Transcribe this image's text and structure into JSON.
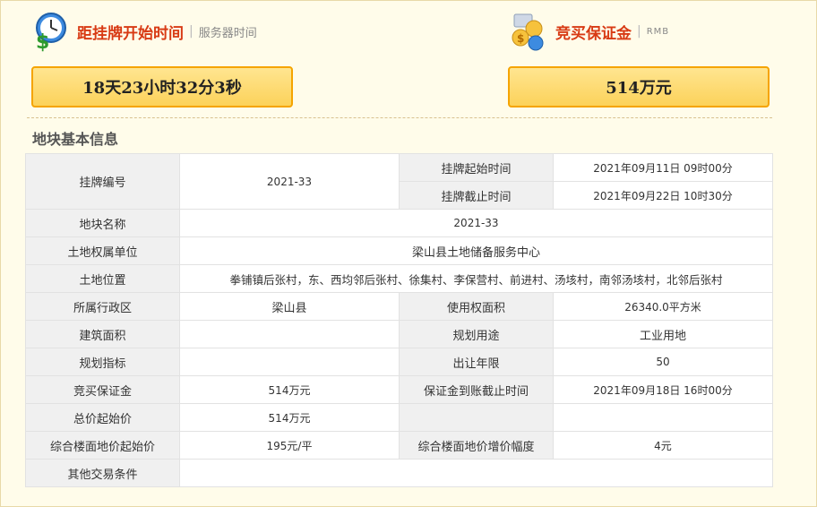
{
  "header": {
    "start_time": {
      "title": "距挂牌开始时间",
      "subtitle": "服务器时间",
      "countdown": "18天23小时32分3秒"
    },
    "deposit": {
      "title": "竞买保证金",
      "subtitle": "RMB",
      "amount": "514万元"
    }
  },
  "section": {
    "title": "地块基本信息"
  },
  "table": {
    "r1": {
      "l1": "挂牌编号",
      "v1": "2021-33",
      "l2a": "挂牌起始时间",
      "v2a": "2021年09月11日 09时00分",
      "l2b": "挂牌截止时间",
      "v2b": "2021年09月22日 10时30分"
    },
    "r3": {
      "l": "地块名称",
      "v": "2021-33"
    },
    "r4": {
      "l": "土地权属单位",
      "v": "梁山县土地储备服务中心"
    },
    "r5": {
      "l": "土地位置",
      "v": "拳铺镇后张村，东、西均邻后张村、徐集村、李保营村、前进村、汤垓村，南邻汤垓村，北邻后张村"
    },
    "r6": {
      "l1": "所属行政区",
      "v1": "梁山县",
      "l2": "使用权面积",
      "v2": "26340.0平方米"
    },
    "r7": {
      "l1": "建筑面积",
      "v1": "",
      "l2": "规划用途",
      "v2": "工业用地"
    },
    "r8": {
      "l1": "规划指标",
      "v1": "",
      "l2": "出让年限",
      "v2": "50"
    },
    "r9": {
      "l1": "竞买保证金",
      "v1": "514万元",
      "l2": "保证金到账截止时间",
      "v2": "2021年09月18日 16时00分"
    },
    "r10": {
      "l1": "总价起始价",
      "v1": "514万元",
      "l2": "",
      "v2": ""
    },
    "r11": {
      "l1": "综合楼面地价起始价",
      "v1": "195元/平",
      "l2": "综合楼面地价增价幅度",
      "v2": "4元"
    },
    "r12": {
      "l": "其他交易条件",
      "v": ""
    }
  }
}
